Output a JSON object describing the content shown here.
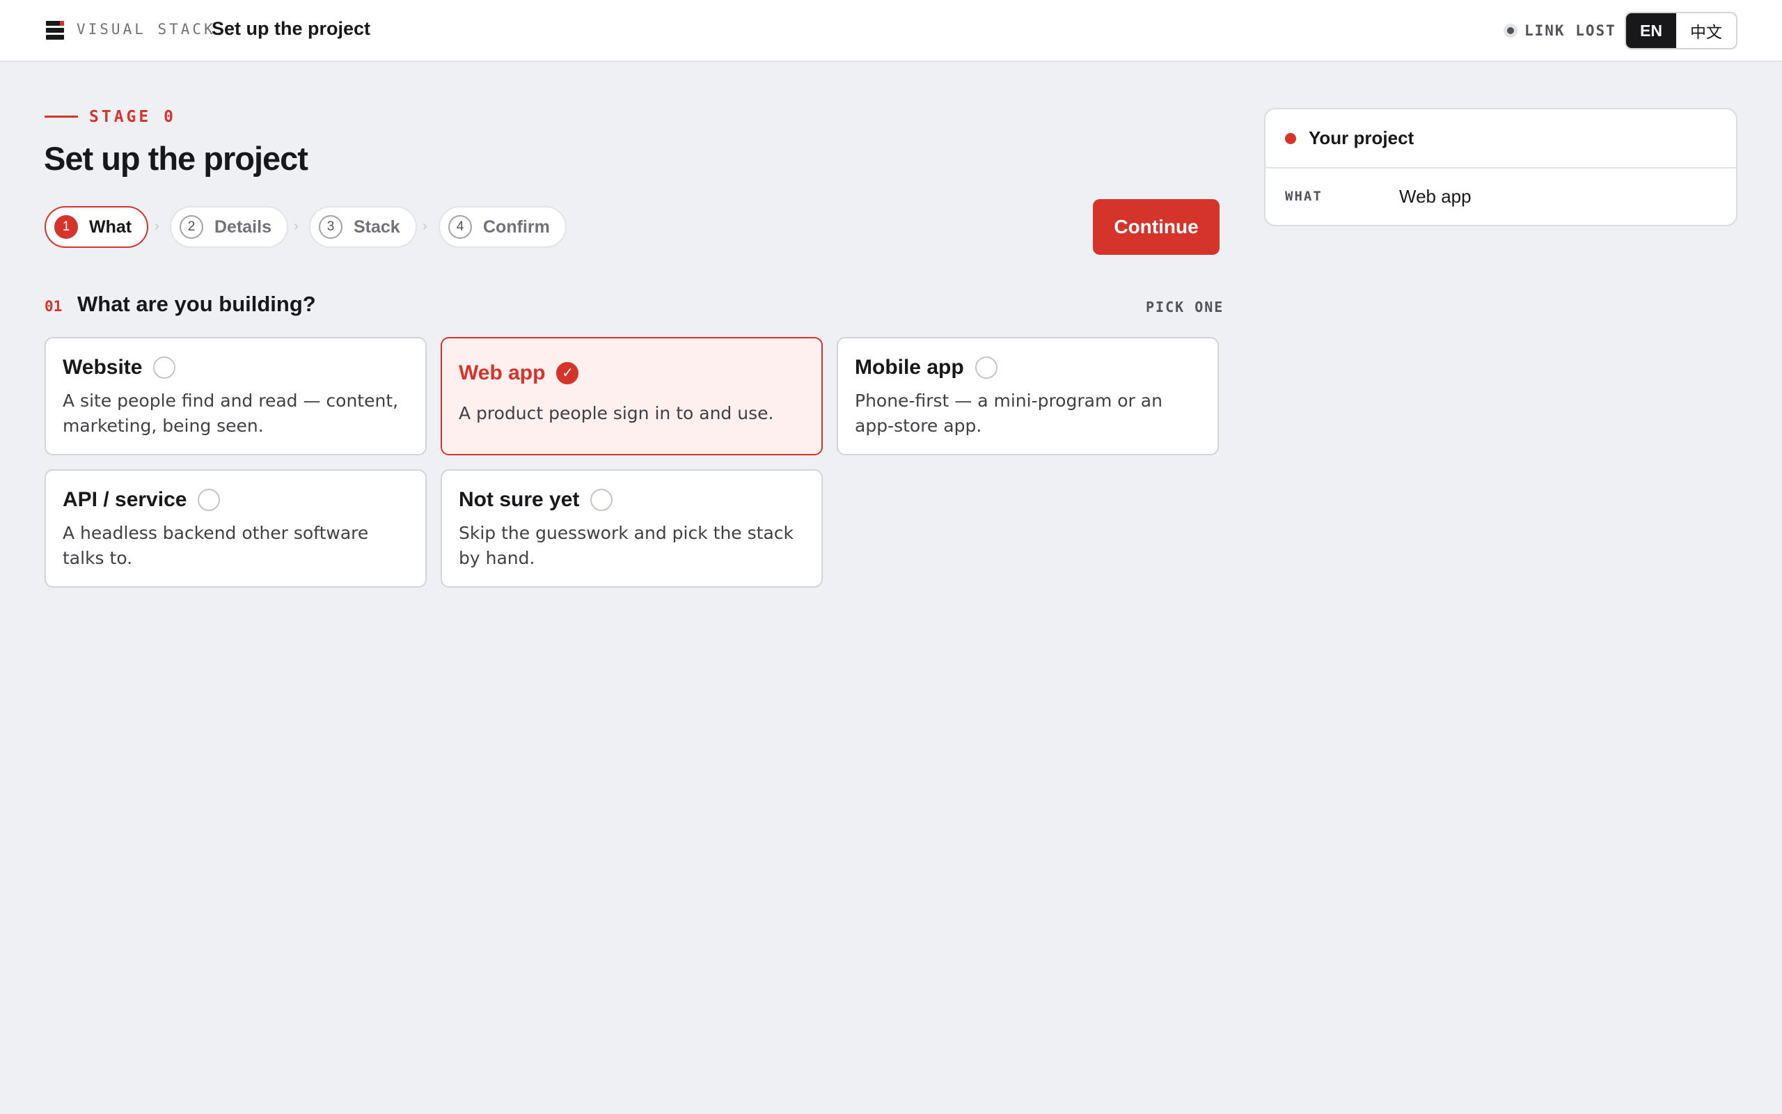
{
  "header": {
    "brand": "VISUAL STACK",
    "title": "Set up the project",
    "link_status": "LINK LOST",
    "languages": [
      "EN",
      "中文"
    ],
    "active_language": "EN"
  },
  "stage": {
    "label": "STAGE 0",
    "title": "Set up the project"
  },
  "steps": [
    {
      "num": "1",
      "label": "What",
      "active": true
    },
    {
      "num": "2",
      "label": "Details",
      "active": false
    },
    {
      "num": "3",
      "label": "Stack",
      "active": false
    },
    {
      "num": "4",
      "label": "Confirm",
      "active": false
    }
  ],
  "step_separator": "›",
  "continue_label": "Continue",
  "question": {
    "num": "01",
    "text": "What are you building?",
    "hint": "PICK ONE"
  },
  "options": [
    {
      "title": "Website",
      "desc": "A site people find and read — content, marketing, being seen.",
      "selected": false
    },
    {
      "title": "Web app",
      "desc": "A product people sign in to and use.",
      "selected": true
    },
    {
      "title": "Mobile app",
      "desc": "Phone-first — a mini-program or an app-store app.",
      "selected": false
    },
    {
      "title": "API / service",
      "desc": "A headless backend other software talks to.",
      "selected": false
    },
    {
      "title": "Not sure yet",
      "desc": "Skip the guesswork and pick the stack by hand.",
      "selected": false
    }
  ],
  "checkmark": "✓",
  "panel": {
    "title": "Your project",
    "rows": [
      {
        "key": "WHAT",
        "value": "Web app"
      }
    ]
  },
  "colors": {
    "accent": "#d5342b",
    "background": "#eff0f3",
    "selected_bg": "#fdf0ef"
  }
}
